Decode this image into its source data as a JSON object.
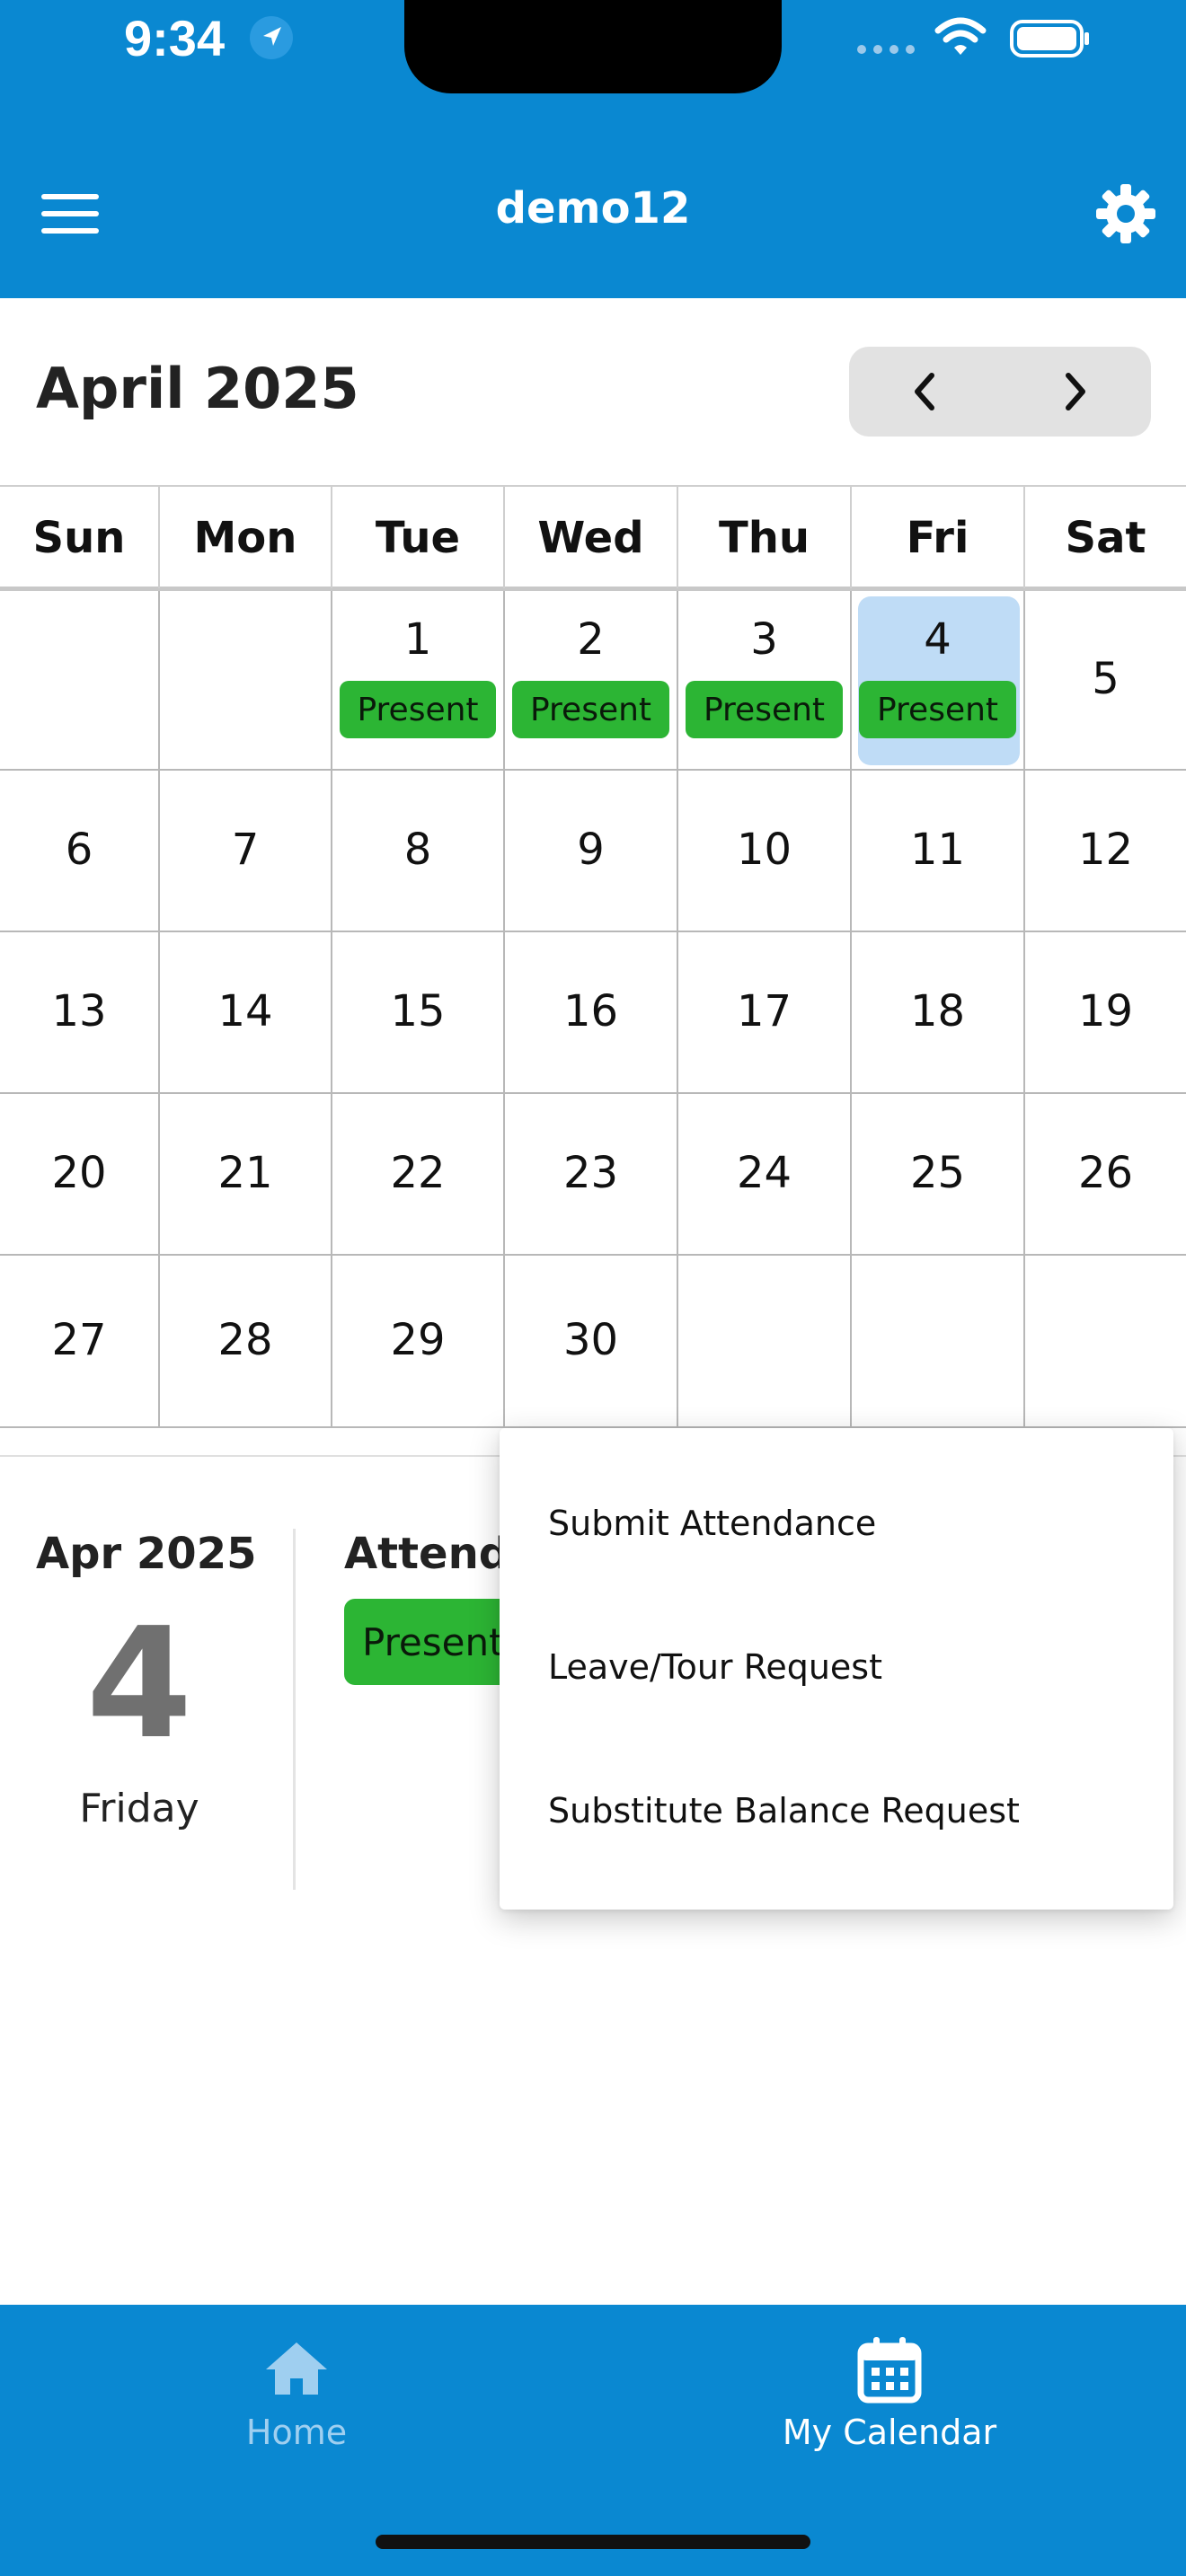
{
  "status_bar": {
    "time": "9:34",
    "icons": [
      "location-arrow-icon",
      "signal-icon",
      "wifi-icon",
      "battery-icon"
    ]
  },
  "header": {
    "title": "demo12",
    "menu_icon": "hamburger-menu-icon",
    "settings_icon": "gear-icon",
    "background": "#0a88d1"
  },
  "calendar": {
    "month_title": "April 2025",
    "prev_icon": "chevron-left-icon",
    "next_icon": "chevron-right-icon",
    "weekdays": [
      "Sun",
      "Mon",
      "Tue",
      "Wed",
      "Thu",
      "Fri",
      "Sat"
    ],
    "weeks": [
      [
        "",
        "",
        "1",
        "2",
        "3",
        "4",
        "5"
      ],
      [
        "6",
        "7",
        "8",
        "9",
        "10",
        "11",
        "12"
      ],
      [
        "13",
        "14",
        "15",
        "16",
        "17",
        "18",
        "19"
      ],
      [
        "20",
        "21",
        "22",
        "23",
        "24",
        "25",
        "26"
      ],
      [
        "27",
        "28",
        "29",
        "30",
        "",
        "",
        ""
      ]
    ],
    "selected_day": "4",
    "attendance": [
      {
        "day": "1",
        "status": "Present"
      },
      {
        "day": "2",
        "status": "Present"
      },
      {
        "day": "3",
        "status": "Present"
      },
      {
        "day": "4",
        "status": "Present"
      }
    ],
    "present_color": "#2cb534",
    "selected_color": "#bfdcf6"
  },
  "detail": {
    "month": "Apr 2025",
    "day": "4",
    "weekday": "Friday",
    "attendance_label": "Attend",
    "attendance_status": "Present"
  },
  "popup_menu": {
    "items": [
      "Submit Attendance",
      "Leave/Tour Request",
      "Substitute Balance Request"
    ]
  },
  "tabbar": {
    "tabs": [
      {
        "label": "Home",
        "icon": "home-icon",
        "active": false
      },
      {
        "label": "My Calendar",
        "icon": "calendar-icon",
        "active": true
      }
    ]
  }
}
